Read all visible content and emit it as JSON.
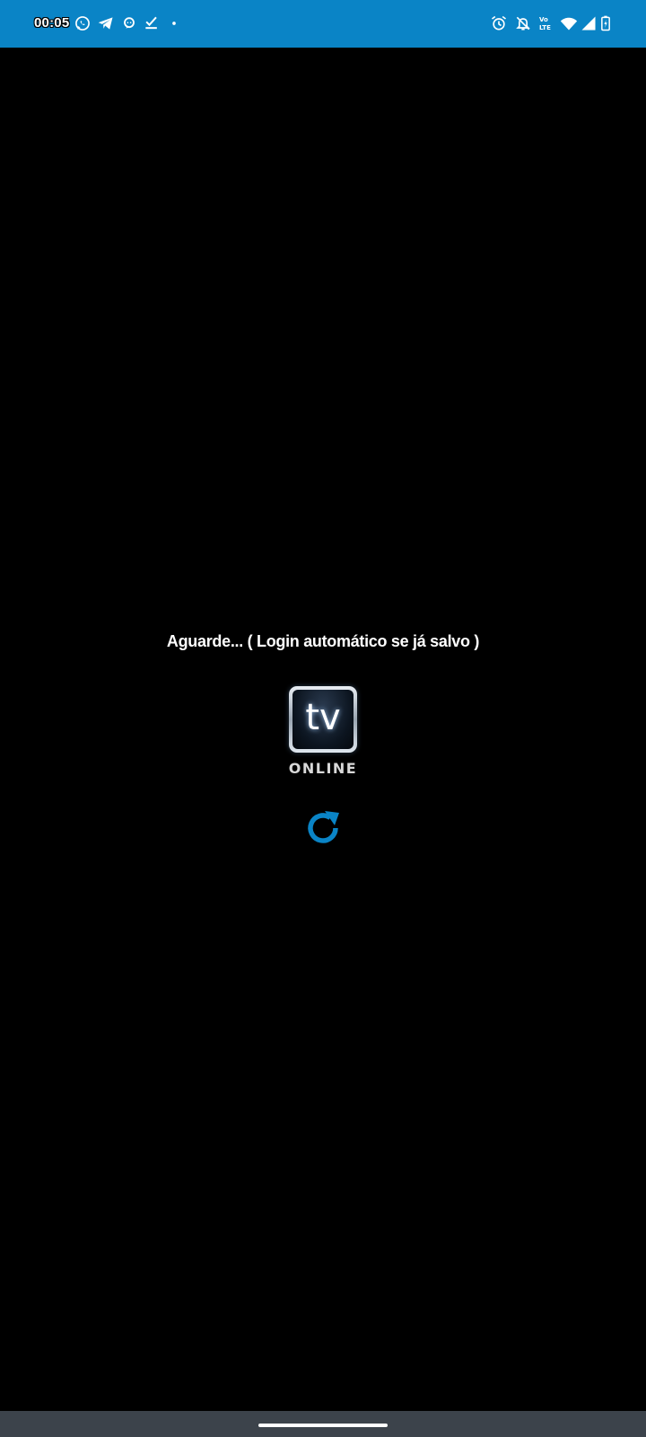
{
  "status_bar": {
    "time": "00:05",
    "background": "#0a84c6",
    "left_icons": [
      "whatsapp-icon",
      "telegram-icon",
      "chat-icon",
      "task-check-icon",
      "more-dot-icon"
    ],
    "right_icons": [
      "alarm-icon",
      "notifications-off-icon",
      "volte-icon",
      "wifi-icon",
      "signal-icon",
      "battery-charging-icon"
    ],
    "volte_label_top": "Vo",
    "volte_label_bottom": "LTE"
  },
  "main": {
    "wait_message": "Aguarde... ( Login automático se já salvo )",
    "logo_text": "tv",
    "logo_subtext": "ONLINE",
    "refresh_color": "#0a84c6"
  },
  "nav_bar": {
    "background": "#3c434b"
  }
}
